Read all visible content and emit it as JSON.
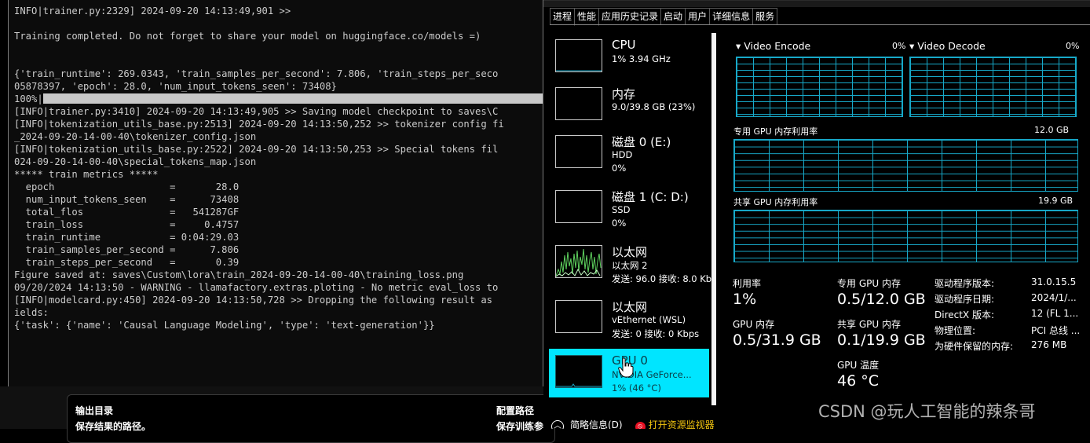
{
  "terminal": {
    "lines": [
      "INFO|trainer.py:2329] 2024-09-20 14:13:49,901 >>",
      "",
      "Training completed. Do not forget to share your model on huggingface.co/models =)",
      "",
      "",
      "{'train_runtime': 269.0343, 'train_samples_per_second': 7.806, 'train_steps_per_seco",
      "05878397, 'epoch': 28.0, 'num_input_tokens_seen': 73408}",
      "[INFO|trainer.py:3410] 2024-09-20 14:13:49,905 >> Saving model checkpoint to saves\\C",
      "[INFO|tokenization_utils_base.py:2513] 2024-09-20 14:13:50,252 >> tokenizer config fi",
      "_2024-09-20-14-00-40\\tokenizer_config.json",
      "[INFO|tokenization_utils_base.py:2522] 2024-09-20 14:13:50,253 >> Special tokens fil",
      "024-09-20-14-00-40\\special_tokens_map.json",
      "***** train metrics *****",
      "  epoch                    =       28.0",
      "  num_input_tokens_seen    =      73408",
      "  total_flos               =   541287GF",
      "  train_loss               =     0.4757",
      "  train_runtime            = 0:04:29.03",
      "  train_samples_per_second =      7.806",
      "  train_steps_per_second   =       0.39",
      "Figure saved at: saves\\Custom\\lora\\train_2024-09-20-14-00-40\\training_loss.png",
      "09/20/2024 14:13:50 - WARNING - llamafactory.extras.ploting - No metric eval_loss to",
      "[INFO|modelcard.py:450] 2024-09-20 14:13:50,728 >> Dropping the following result as",
      "ields:",
      "{'task': {'name': 'Causal Language Modeling', 'type': 'text-generation'}}"
    ],
    "progress_label": "100%|",
    "progress_fraction": 1.0
  },
  "gradio": {
    "output_dir_title": "输出目录",
    "output_dir_desc": "保存结果的路径。",
    "config_path_title": "配置路径",
    "config_path_desc": "保存训练参"
  },
  "taskmgr": {
    "tabs": [
      "进程",
      "性能",
      "应用历史记录",
      "启动",
      "用户",
      "详细信息",
      "服务"
    ],
    "active_tab": "性能",
    "devices": [
      {
        "name": "CPU",
        "sub1": "1% 3.94 GHz",
        "sub2": ""
      },
      {
        "name": "内存",
        "sub1": "9.0/39.8 GB (23%)",
        "sub2": ""
      },
      {
        "name": "磁盘 0 (E:)",
        "sub1": "HDD",
        "sub2": "0%"
      },
      {
        "name": "磁盘 1 (C: D:)",
        "sub1": "SSD",
        "sub2": "0%"
      },
      {
        "name": "以太网",
        "sub1": "以太网 2",
        "sub2": "发送: 96.0 接收: 8.0 Kb"
      },
      {
        "name": "以太网",
        "sub1": "vEthernet (WSL)",
        "sub2": "发送: 0 接收: 0 Kbps"
      },
      {
        "name": "GPU 0",
        "sub1": "NVIDIA GeForce...",
        "sub2": "1% (46 °C)"
      }
    ],
    "selected_device": "GPU 0",
    "footer": {
      "brief": "简略信息(D)",
      "open_monitor": "打开资源监视器"
    },
    "graphs": {
      "video_encode": {
        "label": "Video Encode",
        "value": "0%"
      },
      "video_decode": {
        "label": "Video Decode",
        "value": "0%"
      },
      "dedicated_mem": {
        "label": "专用 GPU 内存利用率",
        "max": "12.0 GB"
      },
      "shared_mem": {
        "label": "共享 GPU 内存利用率",
        "max": "19.9 GB"
      }
    },
    "stats": {
      "utilization_label": "利用率",
      "utilization_value": "1%",
      "gpu_mem_label": "GPU 内存",
      "gpu_mem_value": "0.5/31.9 GB",
      "dedicated_label": "专用 GPU 内存",
      "dedicated_value": "0.5/12.0 GB",
      "shared_label": "共享 GPU 内存",
      "shared_value": "0.1/19.9 GB",
      "temp_label": "GPU 温度",
      "temp_value": "46 °C"
    },
    "driver": [
      {
        "label": "驱动程序版本:",
        "value": "31.0.15.5"
      },
      {
        "label": "驱动程序日期:",
        "value": "2024/1/..."
      },
      {
        "label": "DirectX 版本:",
        "value": "12 (FL 1..."
      },
      {
        "label": "物理位置:",
        "value": "PCI 总线 ..."
      },
      {
        "label": "为硬件保留的内存:",
        "value": "276 MB"
      }
    ]
  },
  "watermark": "CSDN @玩人工智能的辣条哥",
  "colors": {
    "graph_line": "#17a9c9",
    "selected_device": "#00e5ff",
    "terminal_bg": "#0c0c0c"
  }
}
